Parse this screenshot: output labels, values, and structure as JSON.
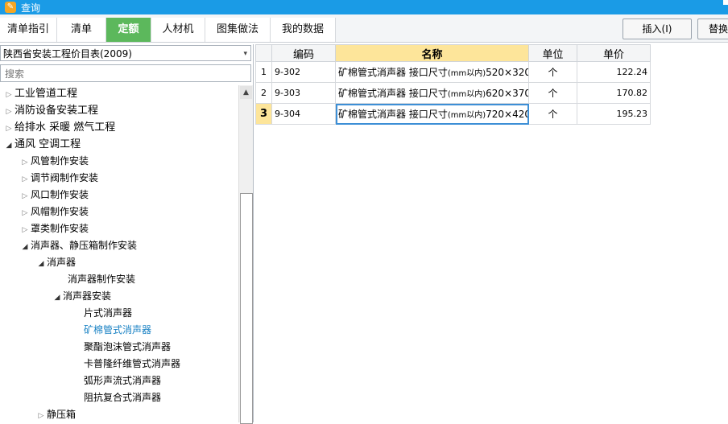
{
  "window": {
    "title": "查询"
  },
  "tabs": [
    {
      "label": "清单指引"
    },
    {
      "label": "清单"
    },
    {
      "label": "定额"
    },
    {
      "label": "人材机"
    },
    {
      "label": "图集做法"
    },
    {
      "label": "我的数据"
    }
  ],
  "active_tab": "定额",
  "toolbar": {
    "insert_label": "插入(I)",
    "replace_label": "替换"
  },
  "catalog": {
    "selected": "陕西省安装工程价目表(2009)"
  },
  "search": {
    "placeholder": "搜索"
  },
  "tree": [
    {
      "label": "工业管道工程",
      "expanded": false
    },
    {
      "label": "消防设备安装工程",
      "expanded": false
    },
    {
      "label": "给排水 采暖 燃气工程",
      "expanded": false
    },
    {
      "label": "通风 空调工程",
      "expanded": true
    },
    {
      "label": "风管制作安装",
      "expanded": false
    },
    {
      "label": "调节阀制作安装",
      "expanded": false
    },
    {
      "label": "风口制作安装",
      "expanded": false
    },
    {
      "label": "风帽制作安装",
      "expanded": false
    },
    {
      "label": "罩类制作安装",
      "expanded": false
    },
    {
      "label": "消声器、静压箱制作安装",
      "expanded": true
    },
    {
      "label": "消声器",
      "expanded": true
    },
    {
      "label": "消声器制作安装"
    },
    {
      "label": "消声器安装",
      "expanded": true
    },
    {
      "label": "片式消声器"
    },
    {
      "label": "矿棉管式消声器",
      "selected": true
    },
    {
      "label": "聚酯泡沫管式消声器"
    },
    {
      "label": "卡普隆纤维管式消声器"
    },
    {
      "label": "弧形声流式消声器"
    },
    {
      "label": "阻抗复合式消声器"
    },
    {
      "label": "静压箱",
      "expanded": false
    }
  ],
  "table": {
    "headers": {
      "code": "编码",
      "name": "名称",
      "unit": "单位",
      "price": "单价"
    },
    "rows": [
      {
        "n": "1",
        "code": "9-302",
        "name_main": "矿棉管式消声器 接口尺寸",
        "name_small": "(mm以内)",
        "name_tail": "520×320",
        "unit": "个",
        "price": "122.24"
      },
      {
        "n": "2",
        "code": "9-303",
        "name_main": "矿棉管式消声器 接口尺寸",
        "name_small": "(mm以内)",
        "name_tail": "620×370",
        "unit": "个",
        "price": "170.82"
      },
      {
        "n": "3",
        "code": "9-304",
        "name_main": "矿棉管式消声器 接口尺寸",
        "name_small": "(mm以内)",
        "name_tail": "720×420",
        "unit": "个",
        "price": "195.23"
      }
    ],
    "current_row": "3"
  },
  "colors": {
    "titlebar": "#1a9be6",
    "active_tab": "#5cb85c",
    "header_highlight": "#fde59a",
    "selected_text": "#1a82c4"
  }
}
